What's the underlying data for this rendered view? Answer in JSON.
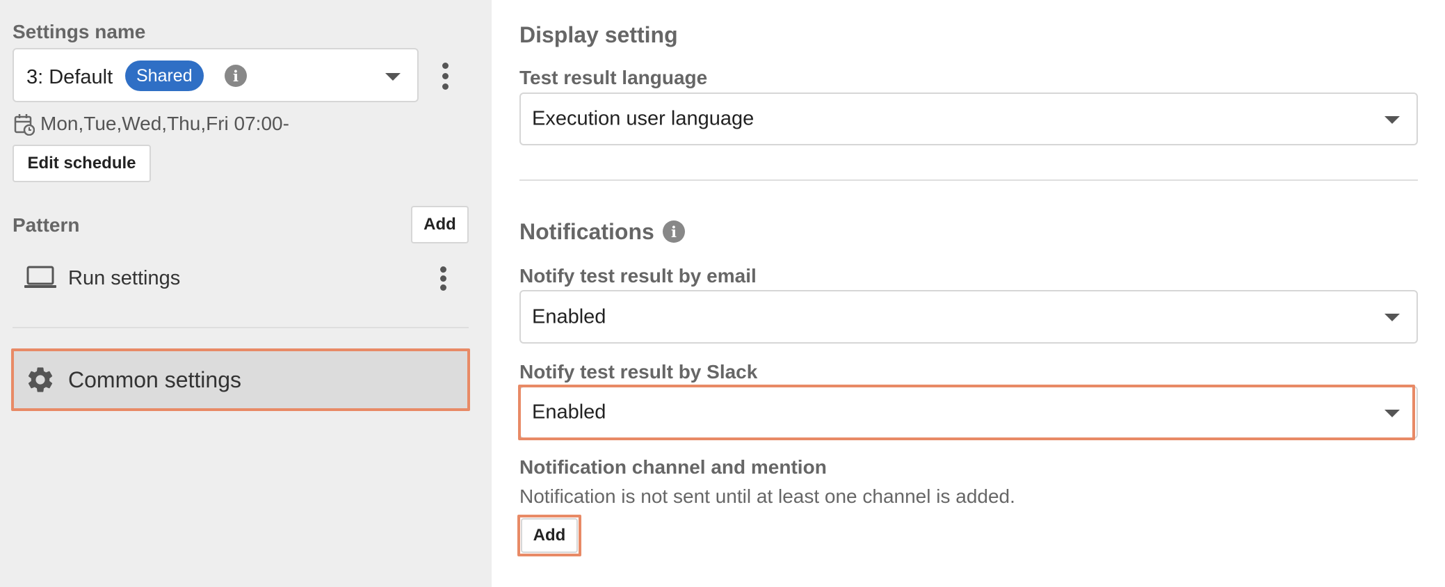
{
  "sidebar": {
    "settings_name_label": "Settings name",
    "settings_select": {
      "value": "3: Default",
      "badge": "Shared"
    },
    "schedule_text": "Mon,Tue,Wed,Thu,Fri 07:00-",
    "edit_schedule_button": "Edit schedule",
    "pattern_label": "Pattern",
    "pattern_add_button": "Add",
    "pattern_items": [
      {
        "label": "Run settings",
        "icon": "laptop-icon"
      }
    ],
    "common_settings": {
      "label": "Common settings",
      "icon": "gear-icon"
    }
  },
  "main": {
    "display_heading": "Display setting",
    "language_label": "Test result language",
    "language_value": "Execution user language",
    "notifications_heading": "Notifications",
    "email_label": "Notify test result by email",
    "email_value": "Enabled",
    "slack_label": "Notify test result by Slack",
    "slack_value": "Enabled",
    "channel_label": "Notification channel and mention",
    "channel_hint": "Notification is not sent until at least one channel is added.",
    "channel_add_button": "Add"
  },
  "colors": {
    "badge": "#2f6fc5",
    "highlight": "#e88a66",
    "sidebar_bg": "#eeeeee"
  }
}
